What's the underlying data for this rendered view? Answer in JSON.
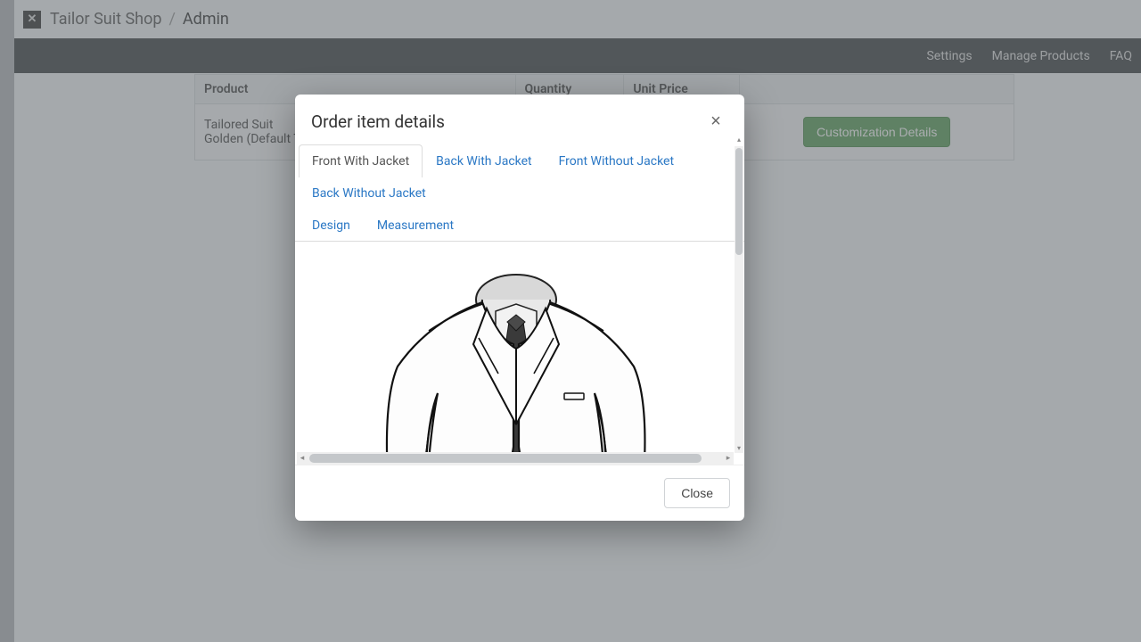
{
  "breadcrumb": {
    "shop": "Tailor Suit Shop",
    "sep": "/",
    "page": "Admin"
  },
  "nav": {
    "settings": "Settings",
    "manage": "Manage Products",
    "faq": "FAQ"
  },
  "table": {
    "headers": {
      "product": "Product",
      "quantity": "Quantity",
      "price": "Unit Price"
    },
    "row": {
      "name": "Tailored Suit",
      "variant": "Golden (Default Title)",
      "action": "Customization Details"
    }
  },
  "modal": {
    "title": "Order item details",
    "tabs": {
      "t0": "Front With Jacket",
      "t1": "Back With Jacket",
      "t2": "Front Without Jacket",
      "t3": "Back Without Jacket",
      "t4": "Design",
      "t5": "Measurement"
    },
    "close": "Close"
  }
}
